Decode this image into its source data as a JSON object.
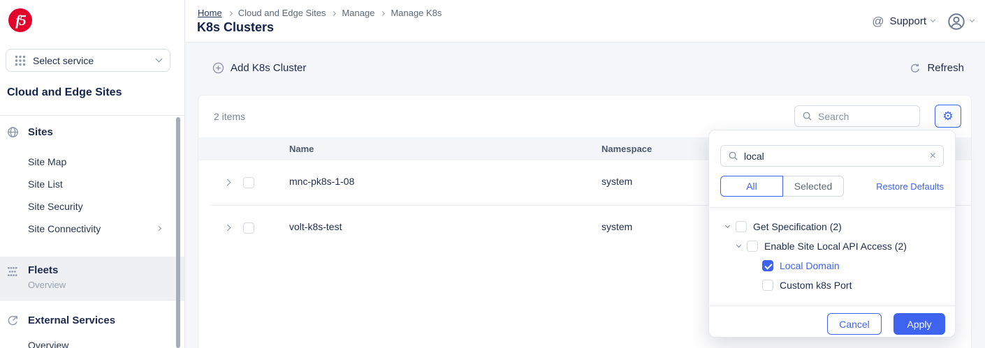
{
  "brand": {
    "logo_text": "f5",
    "logo_color": "#e4002b"
  },
  "sidebar": {
    "service_selector_label": "Select service",
    "heading": "Cloud and Edge Sites",
    "sites_section": {
      "title": "Sites",
      "items": [
        "Site Map",
        "Site List",
        "Site Security",
        "Site Connectivity"
      ]
    },
    "fleets_section": {
      "title": "Fleets",
      "subtitle": "Overview"
    },
    "external_section": {
      "title": "External Services",
      "subtitle": "Overview"
    }
  },
  "header": {
    "breadcrumbs": [
      "Home",
      "Cloud and Edge Sites",
      "Manage",
      "Manage K8s"
    ],
    "title": "K8s Clusters",
    "support_label": "Support"
  },
  "toolbar": {
    "add_label": "Add K8s Cluster",
    "refresh_label": "Refresh"
  },
  "table": {
    "items_count": "2 items",
    "search_placeholder": "Search",
    "columns": [
      "Name",
      "Namespace"
    ],
    "rows": [
      {
        "name": "mnc-pk8s-1-08",
        "namespace": "system"
      },
      {
        "name": "volt-k8s-test",
        "namespace": "system"
      }
    ]
  },
  "popup": {
    "search_value": "local",
    "tabs": {
      "all": "All",
      "selected": "Selected"
    },
    "restore_defaults": "Restore Defaults",
    "tree": [
      {
        "label": "Get Specification (2)",
        "checked": false
      },
      {
        "label": "Enable Site Local API Access (2)",
        "checked": false
      },
      {
        "label": "Local Domain",
        "checked": true
      },
      {
        "label": "Custom k8s Port",
        "checked": false
      }
    ],
    "cancel_label": "Cancel",
    "apply_label": "Apply"
  },
  "icons": {
    "support_glyph": "@",
    "gear_glyph": "⚙",
    "close_glyph": "×"
  },
  "colors": {
    "accent": "#3e63ee",
    "brand_red": "#e4002b",
    "navy": "#1f2b4d",
    "link_blue": "#3e63ee"
  }
}
